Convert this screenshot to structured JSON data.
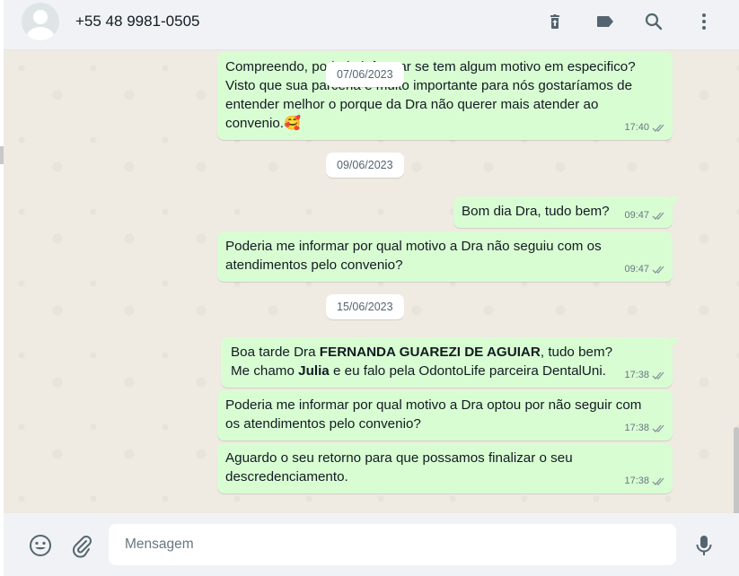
{
  "header": {
    "contact_name": "+55 48 9981-0505"
  },
  "icons": {
    "delete": "trash-icon",
    "label": "label-icon",
    "search": "search-icon",
    "menu": "menu-dots-icon",
    "emoji": "emoji-icon",
    "attach": "attach-icon",
    "mic": "mic-icon",
    "status": "double-check-icon"
  },
  "messages": [
    {
      "id": "m1",
      "lines": [
        "Compreendo, poderia informar se tem algum motivo em especifico?",
        "Visto que sua parceria é muito importante para nós gostaríamos de",
        "entender melhor o porque da Dra não querer mais atender ao",
        "convenio.🥰"
      ],
      "time": "17:40"
    },
    {
      "id": "m2",
      "lines": [
        "Bom dia Dra, tudo bem?"
      ],
      "time": "09:47"
    },
    {
      "id": "m3",
      "lines": [
        "Poderia me informar por qual motivo a Dra não seguiu com os",
        "atendimentos pelo convenio?"
      ],
      "time": "09:47"
    },
    {
      "id": "m4",
      "line1": {
        "pre": "Boa tarde Dra ",
        "bold": "FERNANDA GUAREZI DE AGUIAR",
        "post": ", tudo bem?"
      },
      "line2": {
        "pre": "Me chamo ",
        "bold": "Julia",
        "post": " e eu falo pela OdontoLife parceira DentalUni."
      },
      "time": "17:38"
    },
    {
      "id": "m5",
      "lines": [
        "Poderia me informar por qual motivo a Dra optou por não seguir com",
        "os atendimentos pelo convenio?"
      ],
      "time": "17:38"
    },
    {
      "id": "m6",
      "lines": [
        "Aguardo o seu retorno para que possamos finalizar o seu",
        "descredenciamento."
      ],
      "time": "17:38"
    }
  ],
  "dates": {
    "sticky": "07/06/2023",
    "d1": "09/06/2023",
    "d2": "15/06/2023"
  },
  "composer": {
    "placeholder": "Mensagem"
  }
}
